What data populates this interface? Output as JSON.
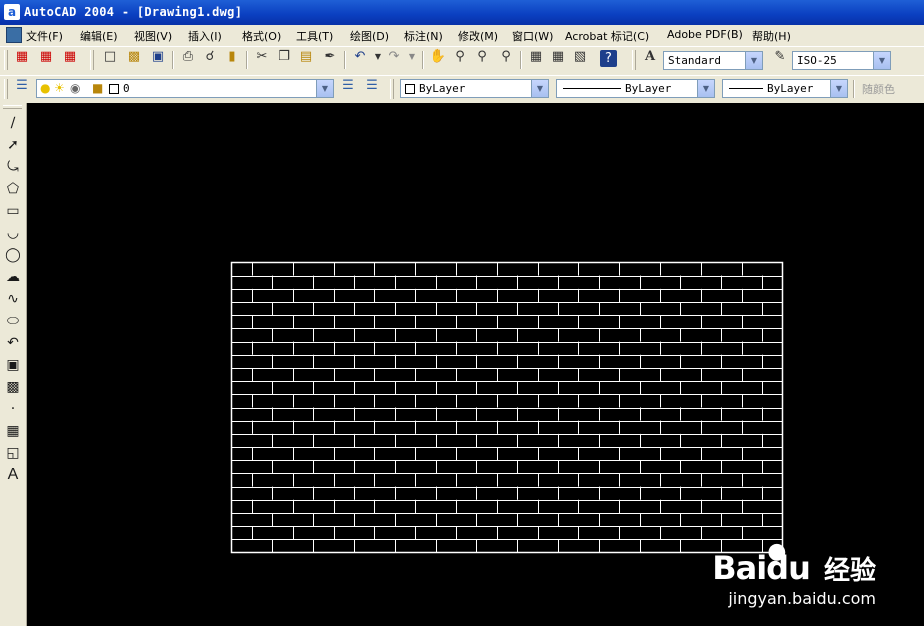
{
  "window": {
    "app_icon": "a",
    "title": "AutoCAD 2004 - [Drawing1.dwg]"
  },
  "menubar": {
    "items": [
      "文件(F)",
      "编辑(E)",
      "视图(V)",
      "插入(I)",
      "格式(O)",
      "工具(T)",
      "绘图(D)",
      "标注(N)",
      "修改(M)",
      "窗口(W)",
      "Acrobat 标记(C)",
      "Adobe PDF(B)",
      "帮助(H)"
    ]
  },
  "toolbar_standard": {
    "icons": [
      "pdf-icon",
      "pdf-icon",
      "pdf-icon",
      "new-icon",
      "open-icon",
      "save-icon",
      "print-icon",
      "preview-icon",
      "publish-icon",
      "cut-icon",
      "copy-icon",
      "paste-icon",
      "match-properties-icon",
      "undo-icon",
      "redo-icon",
      "pan-icon",
      "zoom-realtime-icon",
      "zoom-window-icon",
      "zoom-previous-icon",
      "properties-icon",
      "design-center-icon",
      "tool-palettes-icon",
      "help-icon"
    ],
    "text_style_value": "Standard",
    "dim_style_value": "ISO-25"
  },
  "toolbar_properties": {
    "layer_value": "0",
    "color_value": "ByLayer",
    "linetype_value": "ByLayer",
    "lineweight_value": "ByLayer",
    "plot_style_value": "随颜色"
  },
  "draw_tools": [
    "line-icon",
    "construction-line-icon",
    "polyline-icon",
    "polygon-icon",
    "rectangle-icon",
    "arc-icon",
    "circle-icon",
    "revision-cloud-icon",
    "spline-icon",
    "ellipse-icon",
    "ellipse-arc-icon",
    "insert-block-icon",
    "make-block-icon",
    "point-icon",
    "hatch-icon",
    "region-icon",
    "multiline-text-icon"
  ],
  "draw_tools_last_glyph": "A",
  "drawing": {
    "brick_courses": 22,
    "bricks_per_course": 13.5,
    "line_color": "#FFFFFF",
    "background": "#000000"
  },
  "watermark": {
    "brand_left": "Bai",
    "brand_right": "du",
    "brand_cn": "经验",
    "url": "jingyan.baidu.com"
  }
}
